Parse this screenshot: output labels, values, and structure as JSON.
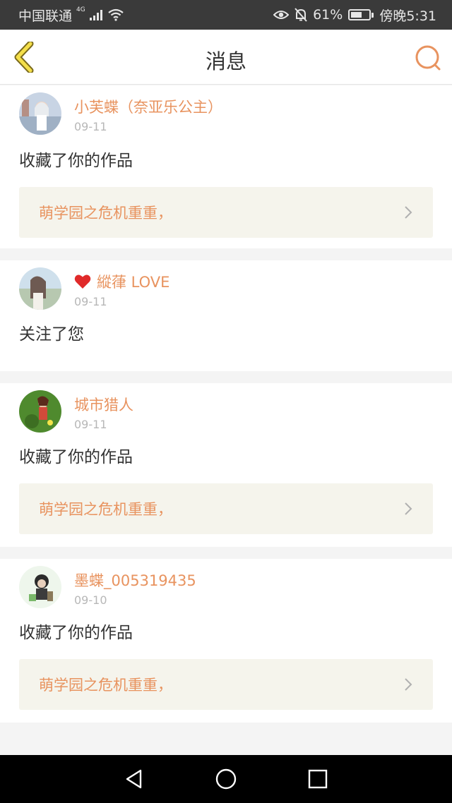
{
  "status_bar": {
    "carrier": "中国联通",
    "network": "4G",
    "battery_percent": "61%",
    "time": "傍晚5:31",
    "battery_level": 0.61
  },
  "header": {
    "title": "消息",
    "back_icon": "chevron-left-icon",
    "search_icon": "search-icon",
    "accent_color": "#e8935f"
  },
  "messages": [
    {
      "username": "小芙蝶（奈亚乐公主）",
      "date": "09-11",
      "action": "收藏了你的作品",
      "work_title": "萌学园之危机重重，"
    },
    {
      "username": "縱葎 LOVE",
      "date": "09-11",
      "action": "关注了您",
      "heart_icon": "heart-icon"
    },
    {
      "username": "城市猎人",
      "date": "09-11",
      "action": "收藏了你的作品",
      "work_title": "萌学园之危机重重，"
    },
    {
      "username": "墨蝶_005319435",
      "date": "09-10",
      "action": "收藏了你的作品",
      "work_title": "萌学园之危机重重，"
    }
  ],
  "nav_bar": {
    "back_icon": "triangle-back-icon",
    "home_icon": "circle-home-icon",
    "recents_icon": "square-recents-icon"
  }
}
